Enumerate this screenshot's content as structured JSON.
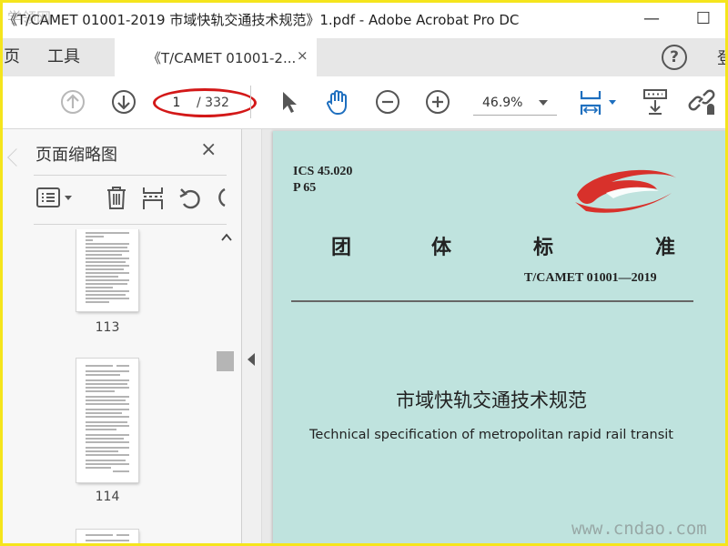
{
  "window": {
    "title": "《T/CAMET 01001-2019 市域快轨交通技术规范》1.pdf - Adobe Acrobat Pro DC",
    "minimize": "—",
    "maximize": "☐"
  },
  "tabs": {
    "home_partial": "页",
    "tools": "工具",
    "active_doc": "《T/CAMET 01001-2...",
    "close": "×",
    "help": "?",
    "overflow": "登"
  },
  "toolbar": {
    "current_page": "1",
    "total_pages": "/ 332",
    "zoom": "46.9%",
    "accent_color": "#1e6fbf",
    "highlight_color": "#d31818",
    "icons": [
      "prev-page-icon",
      "next-page-icon",
      "select-arrow-icon",
      "hand-icon",
      "zoom-out-icon",
      "zoom-in-icon",
      "fit-page-icon",
      "scroll-mode-icon",
      "share-link-icon"
    ]
  },
  "thumbnails": {
    "title": "页面缩略图",
    "close": "×",
    "tool_icons": [
      "options-menu-icon",
      "delete-icon",
      "insert-page-icon",
      "undo-icon",
      "redo-icon"
    ],
    "pages": [
      {
        "label": "113"
      },
      {
        "label": "114"
      }
    ]
  },
  "document": {
    "ics": "ICS 45.020",
    "p": "P 65",
    "standard_chars": [
      "团",
      "体",
      "标",
      "准"
    ],
    "code": "T/CAMET 01001—2019",
    "title_cn": "市域快轨交通技术规范",
    "title_en": "Technical specification of metropolitan rapid rail transit",
    "page_color": "#bfe3de",
    "logo_color": "#d8312b"
  },
  "watermark": {
    "site": "www.cndao.com",
    "corner": "学领网"
  }
}
